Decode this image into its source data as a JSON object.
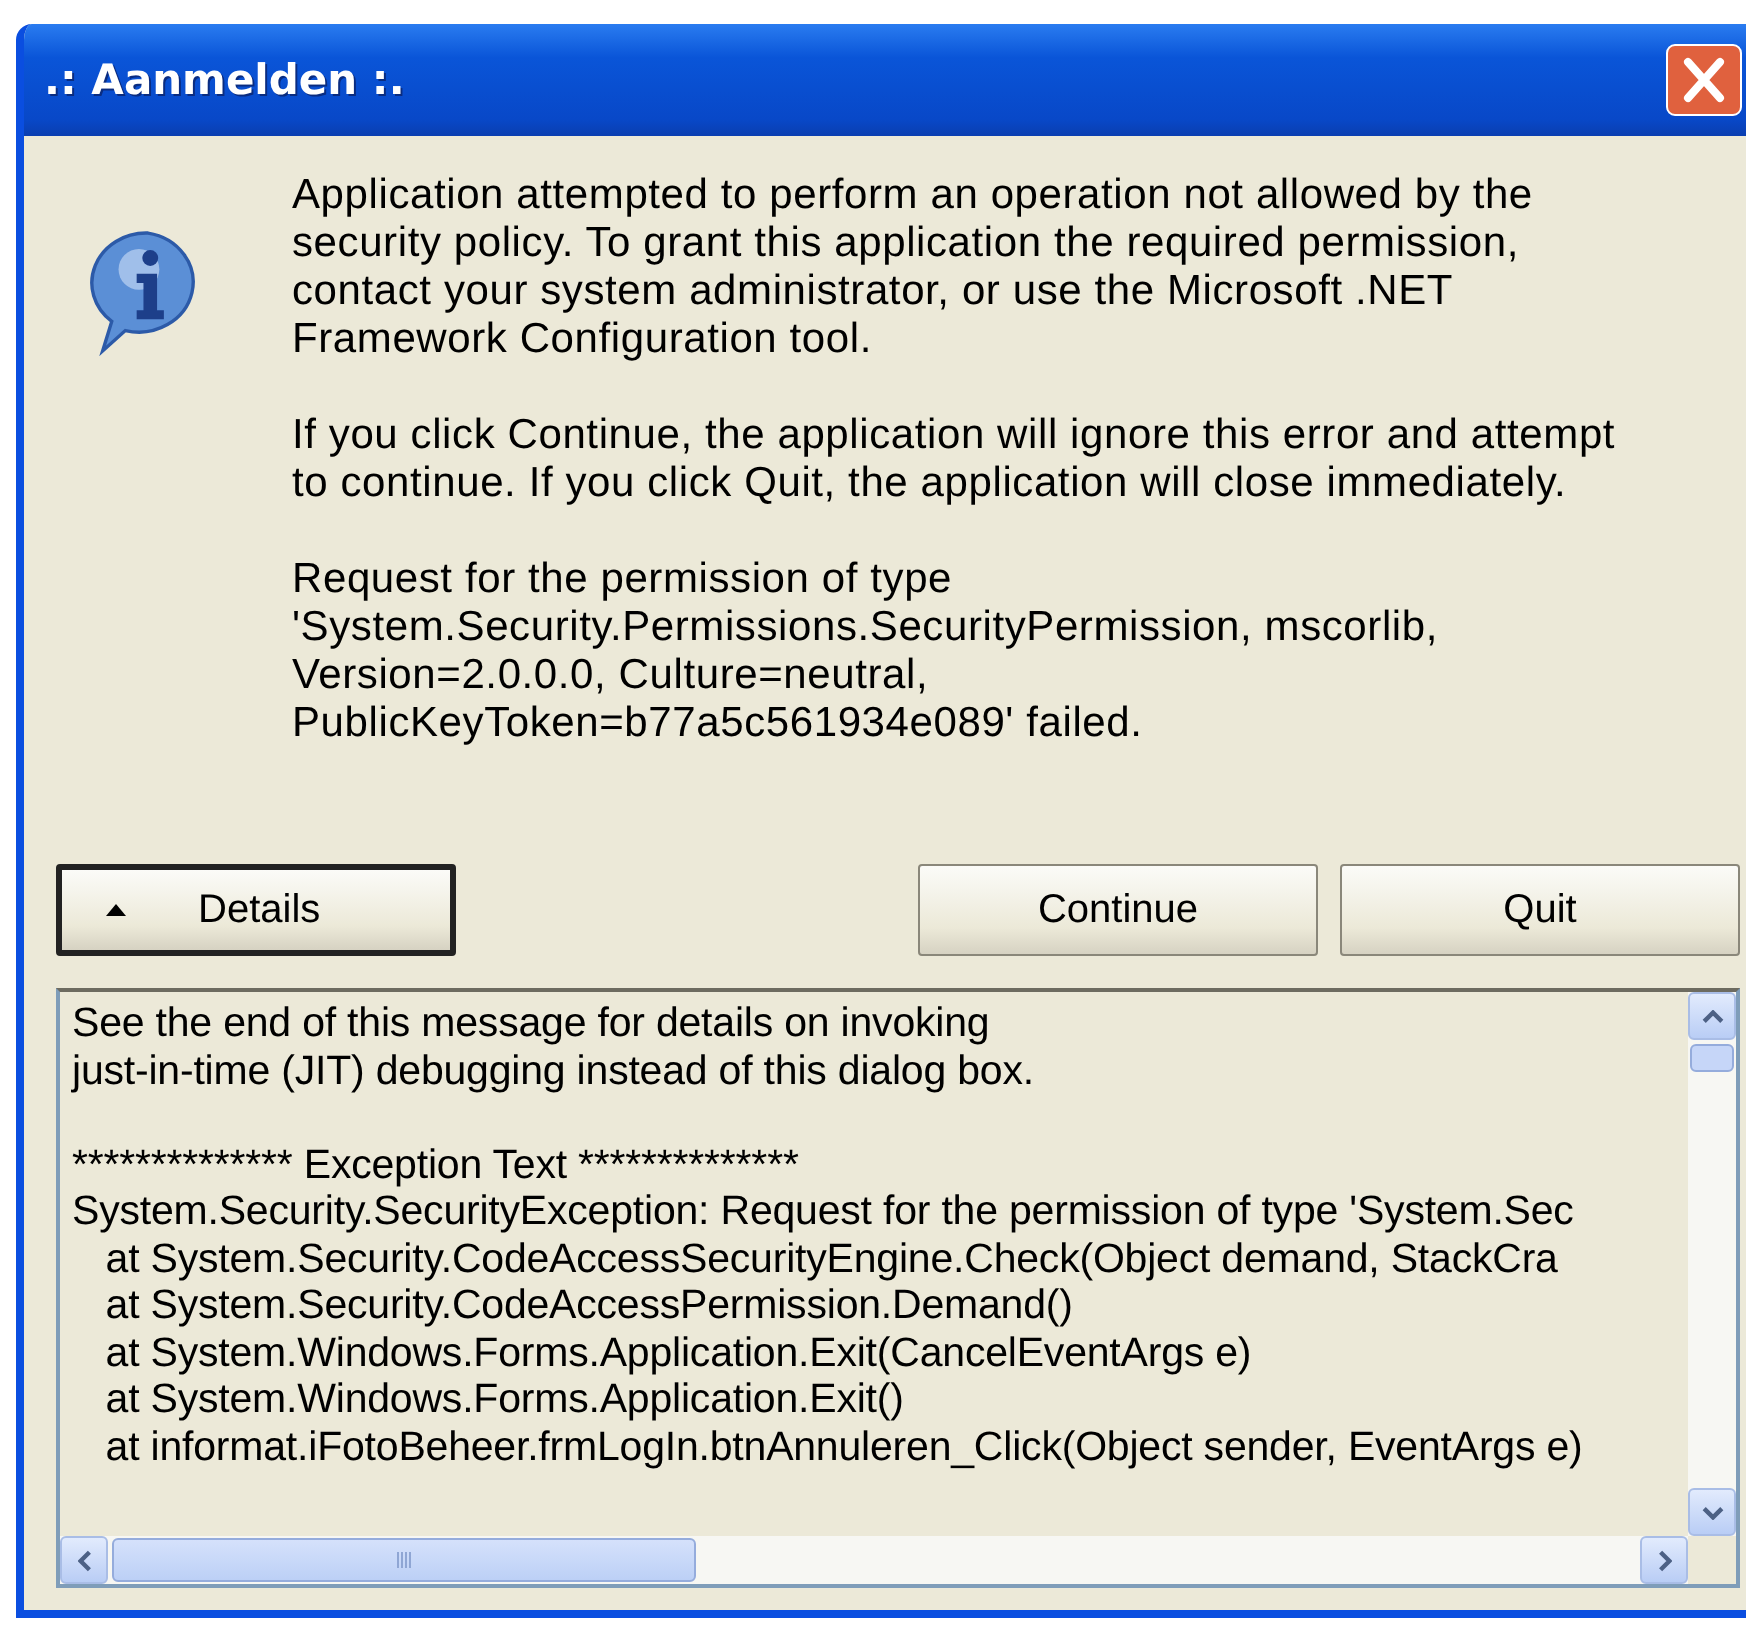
{
  "window": {
    "title": ".: Aanmelden :."
  },
  "message": {
    "paragraphs": [
      [
        "Application attempted to perform an operation not allowed by the",
        "security policy. To grant this application the required permission,",
        "contact your system administrator, or use the Microsoft .NET",
        "Framework Configuration tool."
      ],
      [
        "If you click Continue, the application will ignore this error and attempt",
        "to continue. If you click Quit, the application will close immediately."
      ],
      [
        "Request for the permission of type",
        "'System.Security.Permissions.SecurityPermission,  mscorlib,",
        "Version=2.0.0.0, Culture=neutral,",
        "PublicKeyToken=b77a5c561934e089' failed."
      ]
    ]
  },
  "buttons": [
    {
      "label": "Details",
      "kind": "toggle",
      "default": true
    },
    {
      "label": "Continue",
      "kind": "action",
      "default": false
    },
    {
      "label": "Quit",
      "kind": "action",
      "default": false
    }
  ],
  "details": {
    "paragraphs": [
      [
        "See the end of this message for details on invoking",
        "just-in-time (JIT) debugging instead of this dialog box."
      ],
      [
        "************** Exception Text **************",
        "System.Security.SecurityException: Request for the permission of type 'System.Sec",
        "   at System.Security.CodeAccessSecurityEngine.Check(Object demand, StackCra",
        "   at System.Security.CodeAccessPermission.Demand()",
        "   at System.Windows.Forms.Application.Exit(CancelEventArgs e)",
        "   at System.Windows.Forms.Application.Exit()",
        "   at informat.iFotoBeheer.frmLogIn.btnAnnuleren_Click(Object sender, EventArgs e)"
      ]
    ]
  }
}
